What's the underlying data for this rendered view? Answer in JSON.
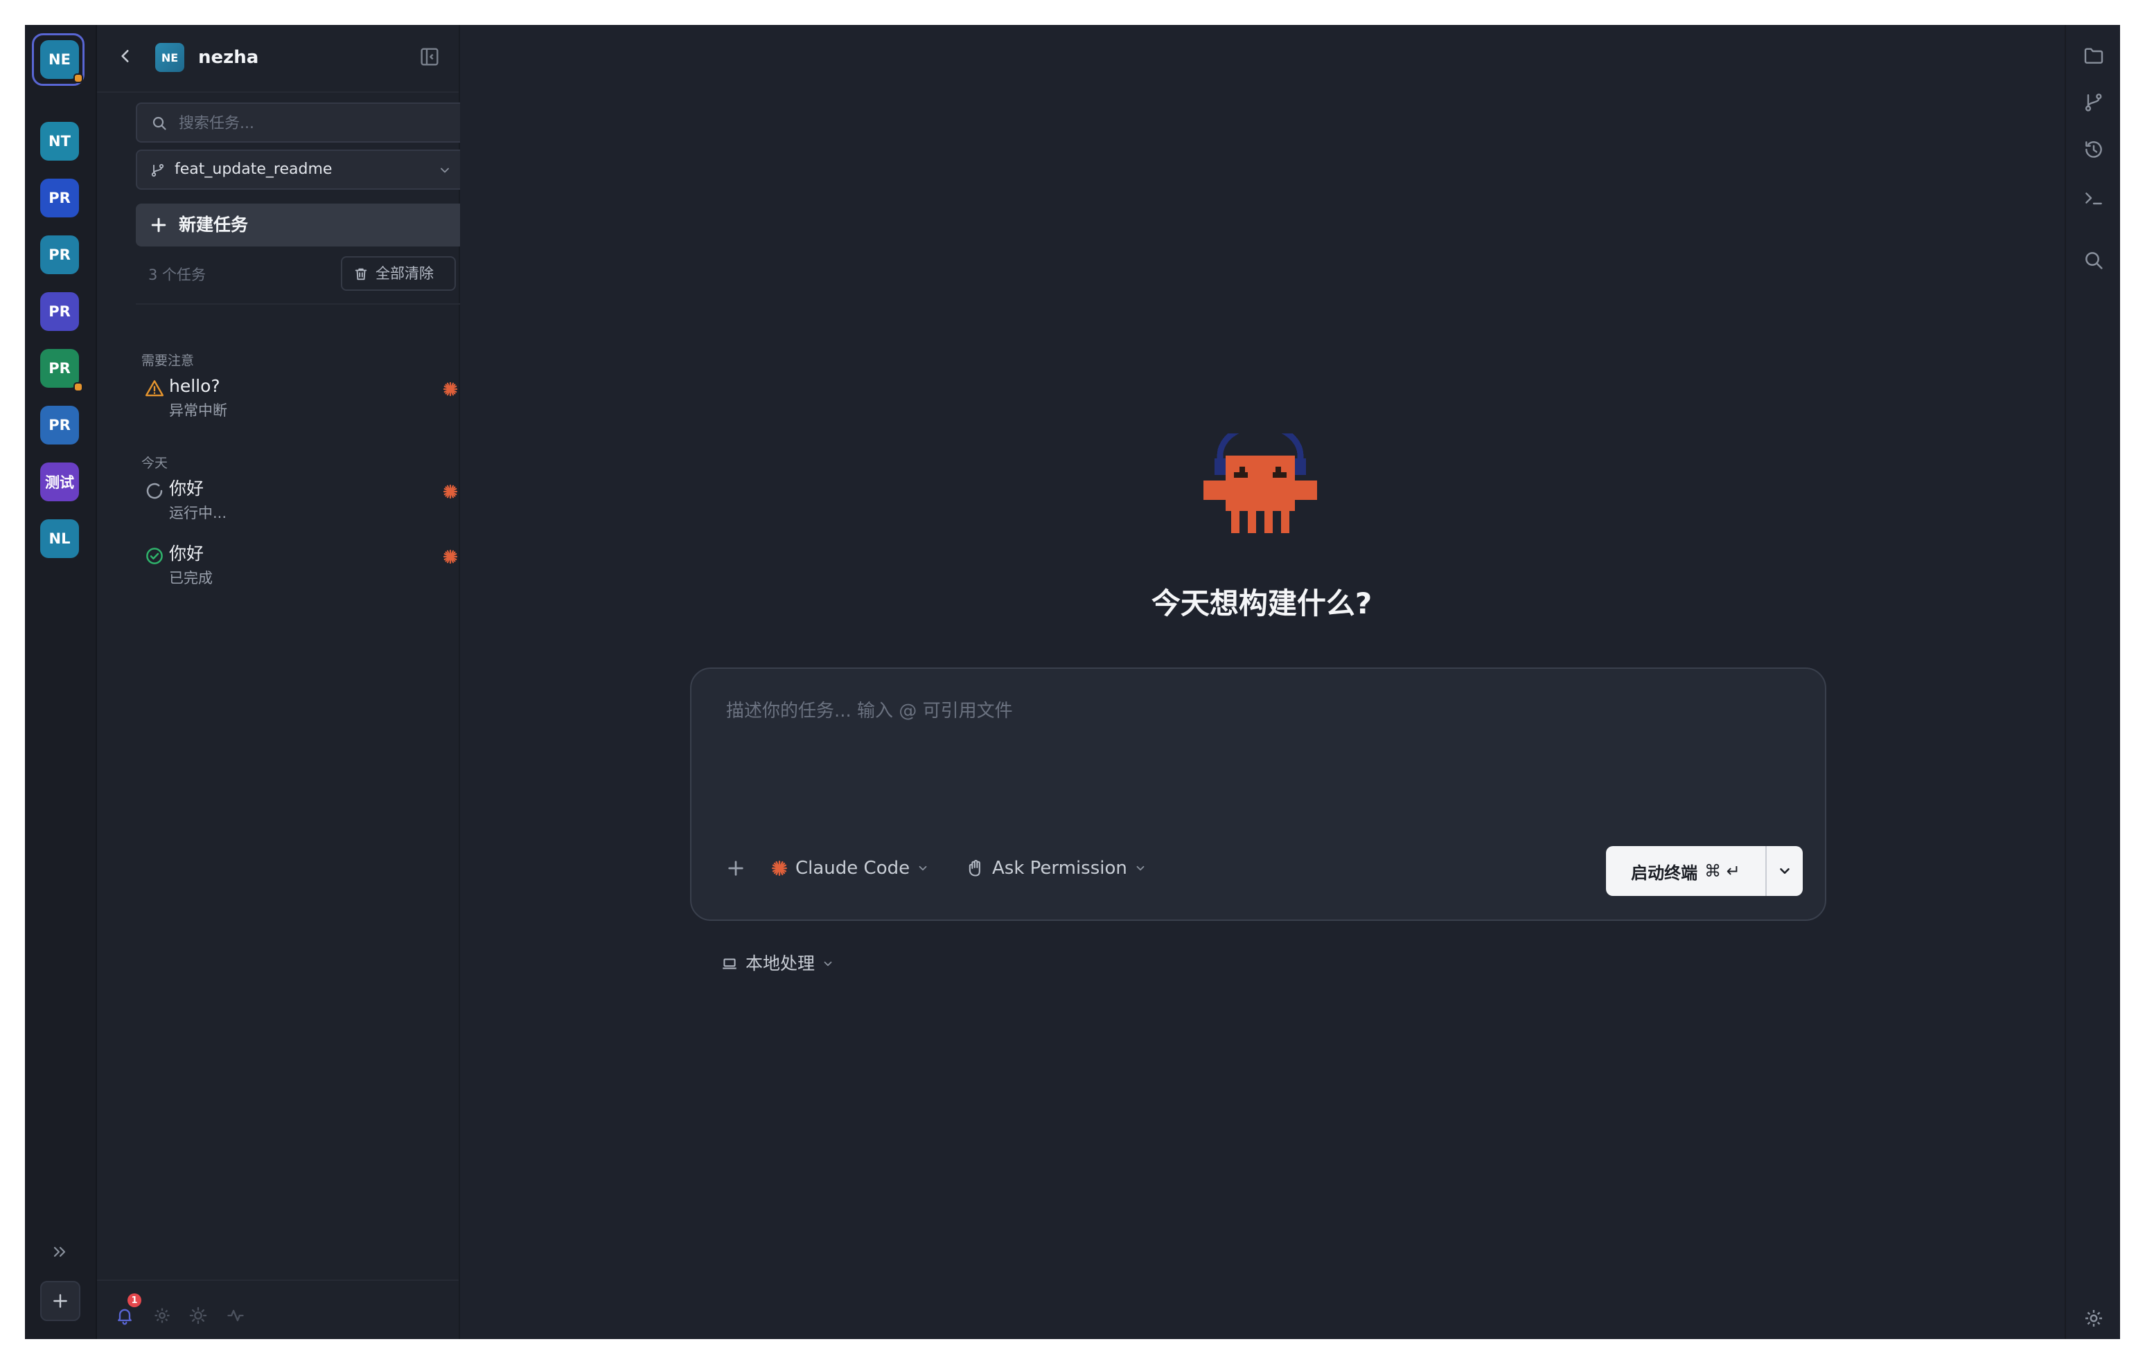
{
  "rail": {
    "projects": [
      {
        "abbr": "NE",
        "color": "#1f7fa6",
        "selected": true,
        "dot": true
      },
      {
        "abbr": "NT",
        "color": "#1e86a8",
        "selected": false,
        "dot": false
      },
      {
        "abbr": "PR",
        "color": "#2550c6",
        "selected": false,
        "dot": false
      },
      {
        "abbr": "PR",
        "color": "#1f7fa6",
        "selected": false,
        "dot": false
      },
      {
        "abbr": "PR",
        "color": "#4a48c2",
        "selected": false,
        "dot": false
      },
      {
        "abbr": "PR",
        "color": "#1f8a5a",
        "selected": false,
        "dot": true
      },
      {
        "abbr": "PR",
        "color": "#2a6ab8",
        "selected": false,
        "dot": false
      },
      {
        "abbr": "测试",
        "color": "#6a3fc4",
        "selected": false,
        "dot": false
      },
      {
        "abbr": "NL",
        "color": "#1f7fa6",
        "selected": false,
        "dot": false
      }
    ]
  },
  "sidebar": {
    "project_abbr": "NE",
    "project_name": "nezha",
    "search_placeholder": "搜索任务...",
    "branch": "feat_update_readme",
    "new_task_label": "新建任务",
    "task_count": "3 个任务",
    "clear_all_label": "全部清除",
    "notification_count": "1",
    "groups": [
      {
        "label": "需要注意",
        "tasks": [
          {
            "title": "hello?",
            "status": "异常中断",
            "icon": "warning-icon"
          }
        ]
      },
      {
        "label": "今天",
        "tasks": [
          {
            "title": "你好",
            "status": "运行中...",
            "icon": "spinner-icon"
          },
          {
            "title": "你好",
            "status": "已完成",
            "icon": "check-circle-icon"
          }
        ]
      }
    ]
  },
  "main": {
    "headline": "今天想构建什么?",
    "prompt_placeholder": "描述你的任务... 输入 @ 可引用文件",
    "agent": "Claude Code",
    "permission": "Ask Permission",
    "launch_label": "启动终端",
    "launch_shortcut": "⌘ ↵",
    "mode": "本地处理"
  },
  "colors": {
    "accent_ring": "#5966d4",
    "agent_orange": "#e0603a",
    "warning": "#e7962e",
    "success": "#2fb36b",
    "notification": "#e5484d"
  }
}
